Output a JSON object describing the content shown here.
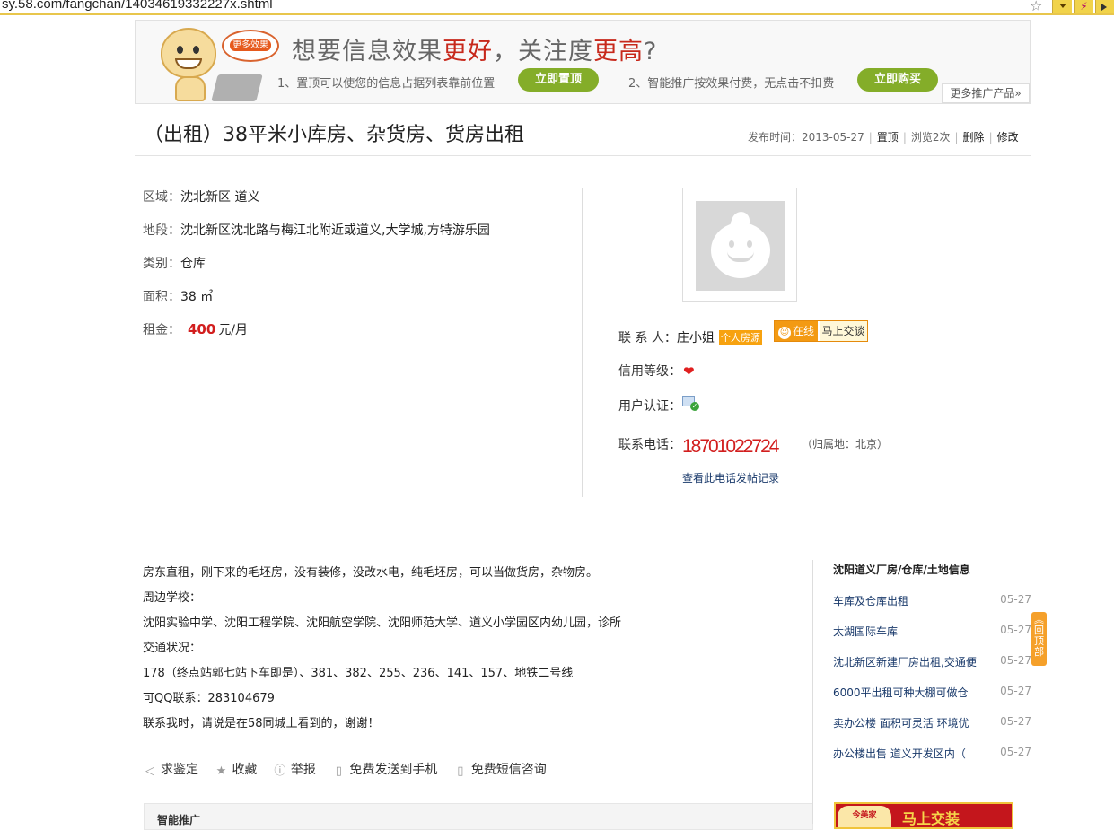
{
  "browser": {
    "url": "sy.58.com/fangchan/14034619332227x.shtml"
  },
  "banner": {
    "bubble": "更多效果",
    "title_pre": "想要信息效果",
    "title_hl1": "更好",
    "title_mid": "，关注度",
    "title_hl2": "更高",
    "title_end": "?",
    "line1": "1、置顶可以使您的信息占据列表靠前位置",
    "btn1": "立即置顶",
    "line2": "2、智能推广按效果付费，无点击不扣费",
    "btn2": "立即购买",
    "more": "更多推广产品»"
  },
  "post": {
    "title": "（出租）38平米小库房、杂货房、货房出租",
    "publish_label": "发布时间：2013-05-27",
    "top": "置顶",
    "views": "浏览2次",
    "delete": "删除",
    "edit": "修改"
  },
  "info": {
    "area_k": "区域：",
    "area_v": "沈北新区 道义",
    "loc_k": "地段：",
    "loc_v": "沈北新区沈北路与梅江北附近或道义,大学城,方特游乐园",
    "type_k": "类别：",
    "type_v": "仓库",
    "size_k": "面积：",
    "size_v": "38 ㎡",
    "rent_k": "租金：",
    "rent_num": "400",
    "rent_unit": "元/月"
  },
  "contact": {
    "person_k": "联 系 人：",
    "person_v": "庄小姐",
    "person_badge": "个人房源",
    "im_online": "在线",
    "im_talk": "马上交谈",
    "credit_k": "信用等级：",
    "cert_k": "用户认证：",
    "phone_k": "联系电话：",
    "phone_v": "18701022724",
    "phone_loc": "（归属地：北京）",
    "phone_log": "查看此电话发帖记录"
  },
  "description": [
    "房东直租，刚下来的毛坯房，没有装修，没改水电，纯毛坯房，可以当做货房，杂物房。",
    "周边学校：",
    "沈阳实验中学、沈阳工程学院、沈阳航空学院、沈阳师范大学、道义小学园区内幼儿园，诊所",
    "交通状况：",
    "178（终点站郭七站下车即是）、381、382、255、236、141、157、地铁二号线",
    "可QQ联系：283104679",
    "联系我时，请说是在58同城上看到的，谢谢！"
  ],
  "actions": {
    "appraise": "求鉴定",
    "favorite": "收藏",
    "report": "举报",
    "send_phone": "免费发送到手机",
    "sms": "免费短信咨询"
  },
  "smart_promo": "智能推广",
  "sidebar": {
    "title": "沈阳道义厂房/仓库/土地信息",
    "items": [
      {
        "title": "车库及仓库出租",
        "date": "05-27"
      },
      {
        "title": "太湖国际车库",
        "date": "05-27"
      },
      {
        "title": "沈北新区新建厂房出租,交通便",
        "date": "05-27"
      },
      {
        "title": "6000平出租可种大棚可做仓",
        "date": "05-27"
      },
      {
        "title": "卖办公楼 面积可灵活 环境优",
        "date": "05-27"
      },
      {
        "title": "办公楼出售 道义开发区内（",
        "date": "05-27"
      }
    ],
    "back_top": "回顶部",
    "ad_logo": "今美家",
    "ad_text": "马上交装"
  },
  "colors": {
    "accent_red": "#d21e1e",
    "green_btn": "#84ad29",
    "link": "#1a3a6b",
    "orange": "#f39a13"
  }
}
